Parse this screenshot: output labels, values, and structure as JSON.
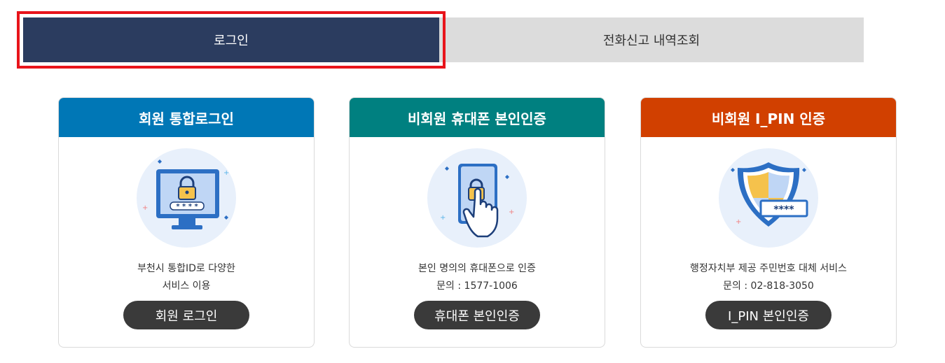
{
  "tabs": {
    "login": "로그인",
    "history": "전화신고 내역조회"
  },
  "cards": {
    "member": {
      "title": "회원 통합로그인",
      "header_color": "#0077b6",
      "desc_line1": "부천시 통합ID로 다양한",
      "desc_line2": "서비스 이용",
      "button": "회원 로그인",
      "illustration_icon": "monitor-lock-icon",
      "password_mask": "* * * *"
    },
    "phone": {
      "title": "비회원 휴대폰 본인인증",
      "header_color": "#008080",
      "desc_line1": "본인 명의의 휴대폰으로 인증",
      "desc_line2": "문의 : 1577-1006",
      "button": "휴대폰 본인인증",
      "illustration_icon": "phone-touch-lock-icon"
    },
    "ipin": {
      "title": "비회원 I_PIN 인증",
      "header_color": "#d14000",
      "desc_line1": "행정자치부 제공 주민번호 대체 서비스",
      "desc_line2": "문의 : 02-818-3050",
      "button": "I_PIN 본인인증",
      "illustration_icon": "shield-password-icon",
      "password_mask": "****"
    }
  },
  "colors": {
    "tab_active": "#2b3c5f",
    "tab_inactive": "#dcdcdc",
    "highlight_border": "#e8141b",
    "button_bg": "#3a3a3a"
  }
}
